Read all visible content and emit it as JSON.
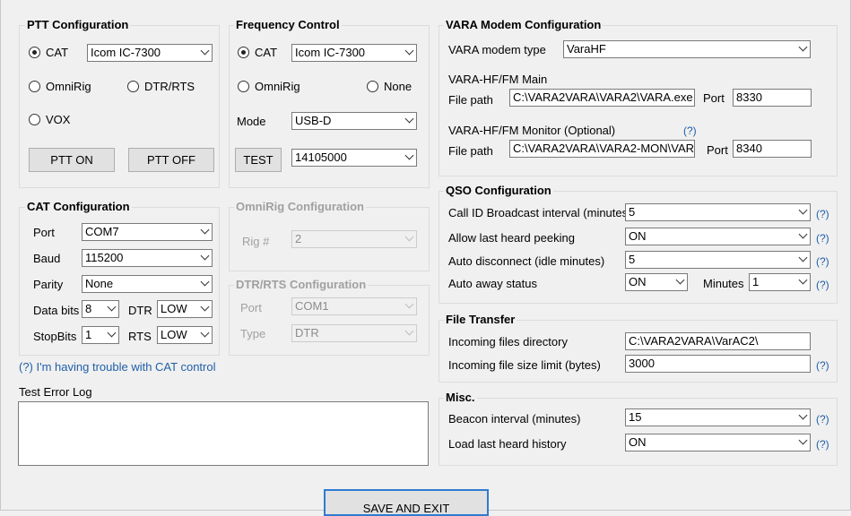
{
  "ptt": {
    "title": "PTT Configuration",
    "cat_label": "CAT",
    "cat_device": "Icom IC-7300",
    "omnirig_label": "OmniRig",
    "dtrrts_label": "DTR/RTS",
    "vox_label": "VOX",
    "selected": "CAT",
    "ptt_on_label": "PTT ON",
    "ptt_off_label": "PTT OFF"
  },
  "freq": {
    "title": "Frequency Control",
    "cat_label": "CAT",
    "cat_device": "Icom IC-7300",
    "omnirig_label": "OmniRig",
    "none_label": "None",
    "selected": "CAT",
    "mode_label": "Mode",
    "mode_value": "USB-D",
    "test_label": "TEST",
    "frequency": "14105000"
  },
  "cat": {
    "title": "CAT Configuration",
    "port_label": "Port",
    "port_value": "COM7",
    "baud_label": "Baud",
    "baud_value": "115200",
    "parity_label": "Parity",
    "parity_value": "None",
    "databits_label": "Data bits",
    "databits_value": "8",
    "dtr_label": "DTR",
    "dtr_value": "LOW",
    "stopbits_label": "StopBits",
    "stopbits_value": "1",
    "rts_label": "RTS",
    "rts_value": "LOW",
    "trouble_link": "(?) I'm having trouble with CAT control"
  },
  "omnirig": {
    "title": "OmniRig Configuration",
    "rig_label": "Rig #",
    "rig_value": "2"
  },
  "dtrrts": {
    "title": "DTR/RTS Configuration",
    "port_label": "Port",
    "port_value": "COM1",
    "type_label": "Type",
    "type_value": "DTR"
  },
  "error_log": {
    "label": "Test Error Log",
    "value": ""
  },
  "vara": {
    "title": "VARA Modem Configuration",
    "type_label": "VARA modem type",
    "type_value": "VaraHF",
    "main_label": "VARA-HF/FM Main",
    "main_filepath_label": "File path",
    "main_filepath": "C:\\VARA2VARA\\VARA2\\VARA.exe",
    "main_port_label": "Port",
    "main_port": "8330",
    "monitor_label": "VARA-HF/FM Monitor (Optional)",
    "monitor_help": "(?)",
    "monitor_filepath_label": "File path",
    "monitor_filepath": "C:\\VARA2VARA\\VARA2-MON\\VAR",
    "monitor_port_label": "Port",
    "monitor_port": "8340"
  },
  "qso": {
    "title": "QSO Configuration",
    "callid_label": "Call ID Broadcast interval (minutes)",
    "callid_value": "5",
    "peeking_label": "Allow last heard peeking",
    "peeking_value": "ON",
    "autodisc_label": "Auto disconnect (idle minutes)",
    "autodisc_value": "5",
    "away_label": "Auto away status",
    "away_value": "ON",
    "minutes_label": "Minutes",
    "minutes_value": "1",
    "help": "(?)"
  },
  "file_transfer": {
    "title": "File Transfer",
    "dir_label": "Incoming files directory",
    "dir_value": "C:\\VARA2VARA\\VarAC2\\",
    "limit_label": "Incoming file size limit (bytes)",
    "limit_value": "3000",
    "help": "(?)"
  },
  "misc": {
    "title": "Misc.",
    "beacon_label": "Beacon interval (minutes)",
    "beacon_value": "15",
    "history_label": "Load last heard history",
    "history_value": "ON",
    "help": "(?)"
  },
  "footer": {
    "save_label": "SAVE AND EXIT"
  }
}
